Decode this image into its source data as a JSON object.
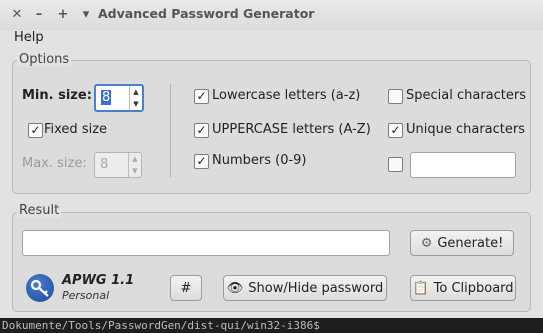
{
  "window": {
    "title": "Advanced Password Generator",
    "controls": {
      "close": "✕",
      "minimize": "–",
      "maximize": "+",
      "menu": "▾"
    }
  },
  "menubar": {
    "help": "Help"
  },
  "options": {
    "title": "Options",
    "min_size_label": "Min. size:",
    "min_size_value": "8",
    "fixed_size_label": "Fixed size",
    "fixed_size_checked": true,
    "max_size_label": "Max. size:",
    "max_size_value": "8",
    "lowercase_label": "Lowercase letters (a-z)",
    "lowercase_checked": true,
    "uppercase_label": "UPPERCASE letters (A-Z)",
    "uppercase_checked": true,
    "numbers_label": "Numbers (0-9)",
    "numbers_checked": true,
    "special_label": "Special characters",
    "special_checked": false,
    "unique_label": "Unique characters",
    "unique_checked": true,
    "custom_checked": false,
    "custom_value": ""
  },
  "result": {
    "title": "Result",
    "password_value": "",
    "generate_label": "Generate!"
  },
  "footer": {
    "app_name": "APWG 1.1",
    "edition": "Personal",
    "hash_label": "#",
    "showhide_label": "Show/Hide password",
    "clipboard_label": "To Clipboard"
  },
  "background_terminal": "Dokumente/Tools/PasswordGen/dist-qui/win32-i386$"
}
